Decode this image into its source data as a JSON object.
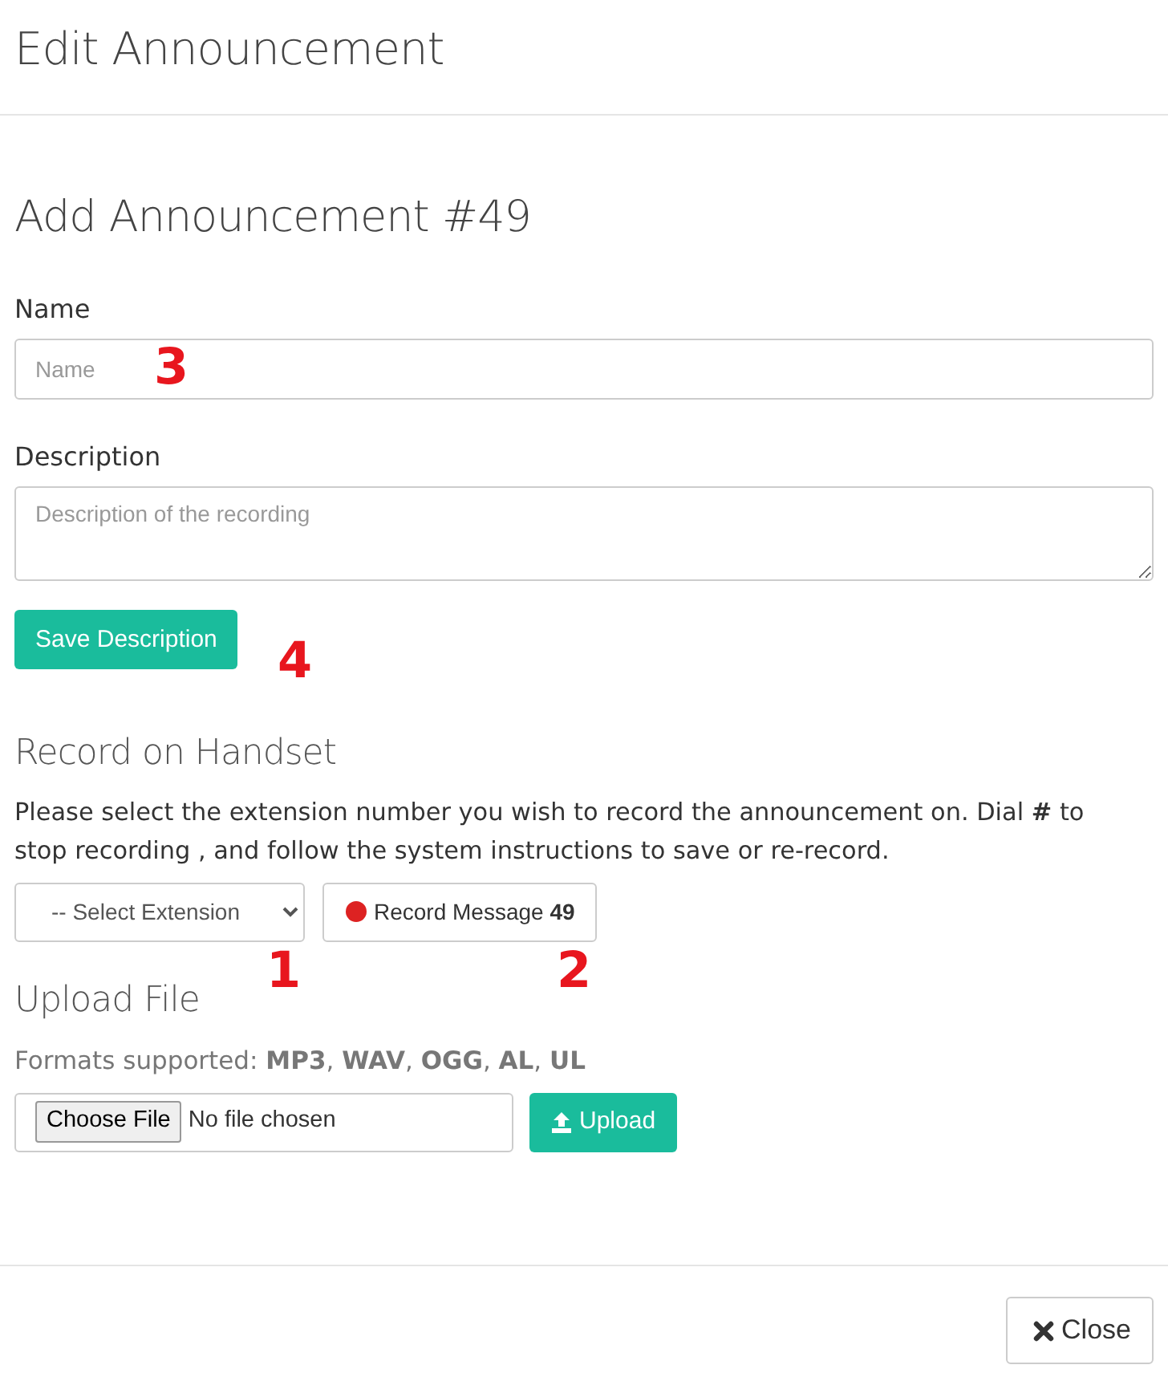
{
  "modal": {
    "title": "Edit Announcement"
  },
  "form": {
    "heading": "Add Announcement #49",
    "name": {
      "label": "Name",
      "placeholder": "Name",
      "callout": "3"
    },
    "description": {
      "label": "Description",
      "placeholder": "Description of the recording"
    },
    "save_button": {
      "label": "Save Description",
      "callout": "4"
    }
  },
  "record": {
    "heading": "Record on Handset",
    "instructions": "Please select the extension number you wish to record the announcement on. Dial **#** to stop recording , and follow the system instructions to save or re-record.",
    "extension_select": {
      "label": "-- Select Extension",
      "callout": "1"
    },
    "record_button": {
      "label": "Record Message",
      "number": "49",
      "callout": "2"
    }
  },
  "upload": {
    "heading": "Upload File",
    "formats": "Formats supported: **MP3**, **WAV**, **OGG**, **AL**, **UL**",
    "choose_button": "Choose File",
    "file_status": "No file chosen",
    "upload_button": "Upload"
  },
  "footer": {
    "close_button": "Close"
  }
}
